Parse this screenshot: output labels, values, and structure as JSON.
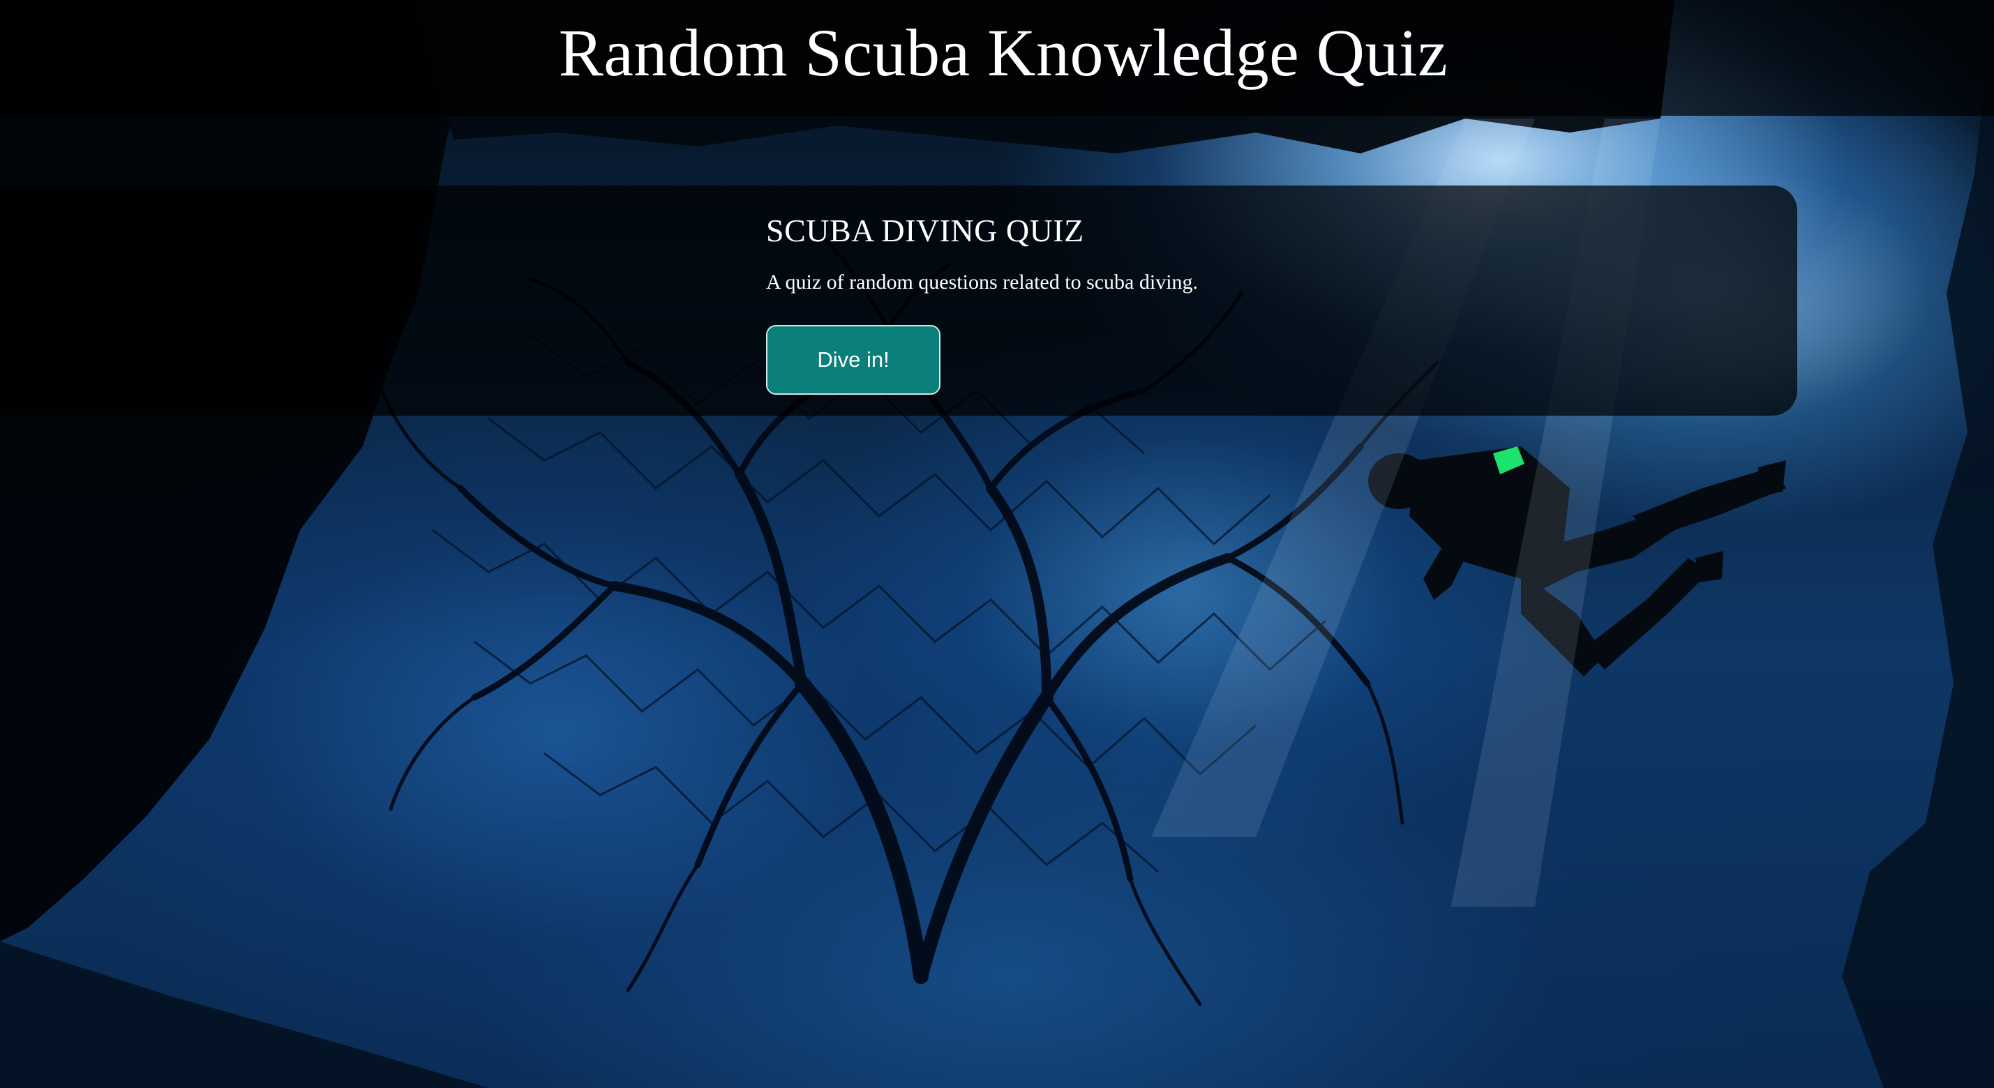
{
  "page": {
    "title": "Random Scuba Knowledge Quiz"
  },
  "quiz_card": {
    "title": "SCUBA DIVING QUIZ",
    "description": "A quiz of random questions related to scuba diving.",
    "start_button_label": "Dive in!"
  },
  "background": {
    "icon": "underwater-scene-image"
  },
  "colors": {
    "button_background": "#0b7f7a",
    "button_border": "#cfe9e6",
    "overlay": "rgba(0,0,0,0.72)",
    "text": "#ffffff"
  }
}
